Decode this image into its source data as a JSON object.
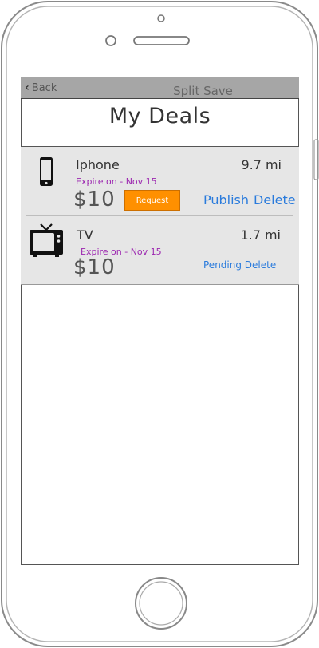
{
  "navbar": {
    "back_label": "Back",
    "title": "Split Save"
  },
  "page": {
    "title": "My Deals"
  },
  "deals": [
    {
      "name": "Iphone",
      "icon": "smartphone-icon",
      "distance": "9.7 mi",
      "expire": "Expire on - Nov 15",
      "price": "$10",
      "request_label": "Request",
      "publish_label": "Publish",
      "delete_label": "Delete"
    },
    {
      "name": "TV",
      "icon": "tv-icon",
      "distance": "1.7 mi",
      "expire": "Expire on - Nov 15",
      "price": "$10",
      "pending_delete_label": "Pending Delete"
    }
  ],
  "colors": {
    "accent_orange": "#ff9000",
    "link_blue": "#2a7bdc",
    "expire_purple": "#9c27b0",
    "navbar_gray": "#a6a6a6",
    "list_bg": "#e6e6e6"
  }
}
